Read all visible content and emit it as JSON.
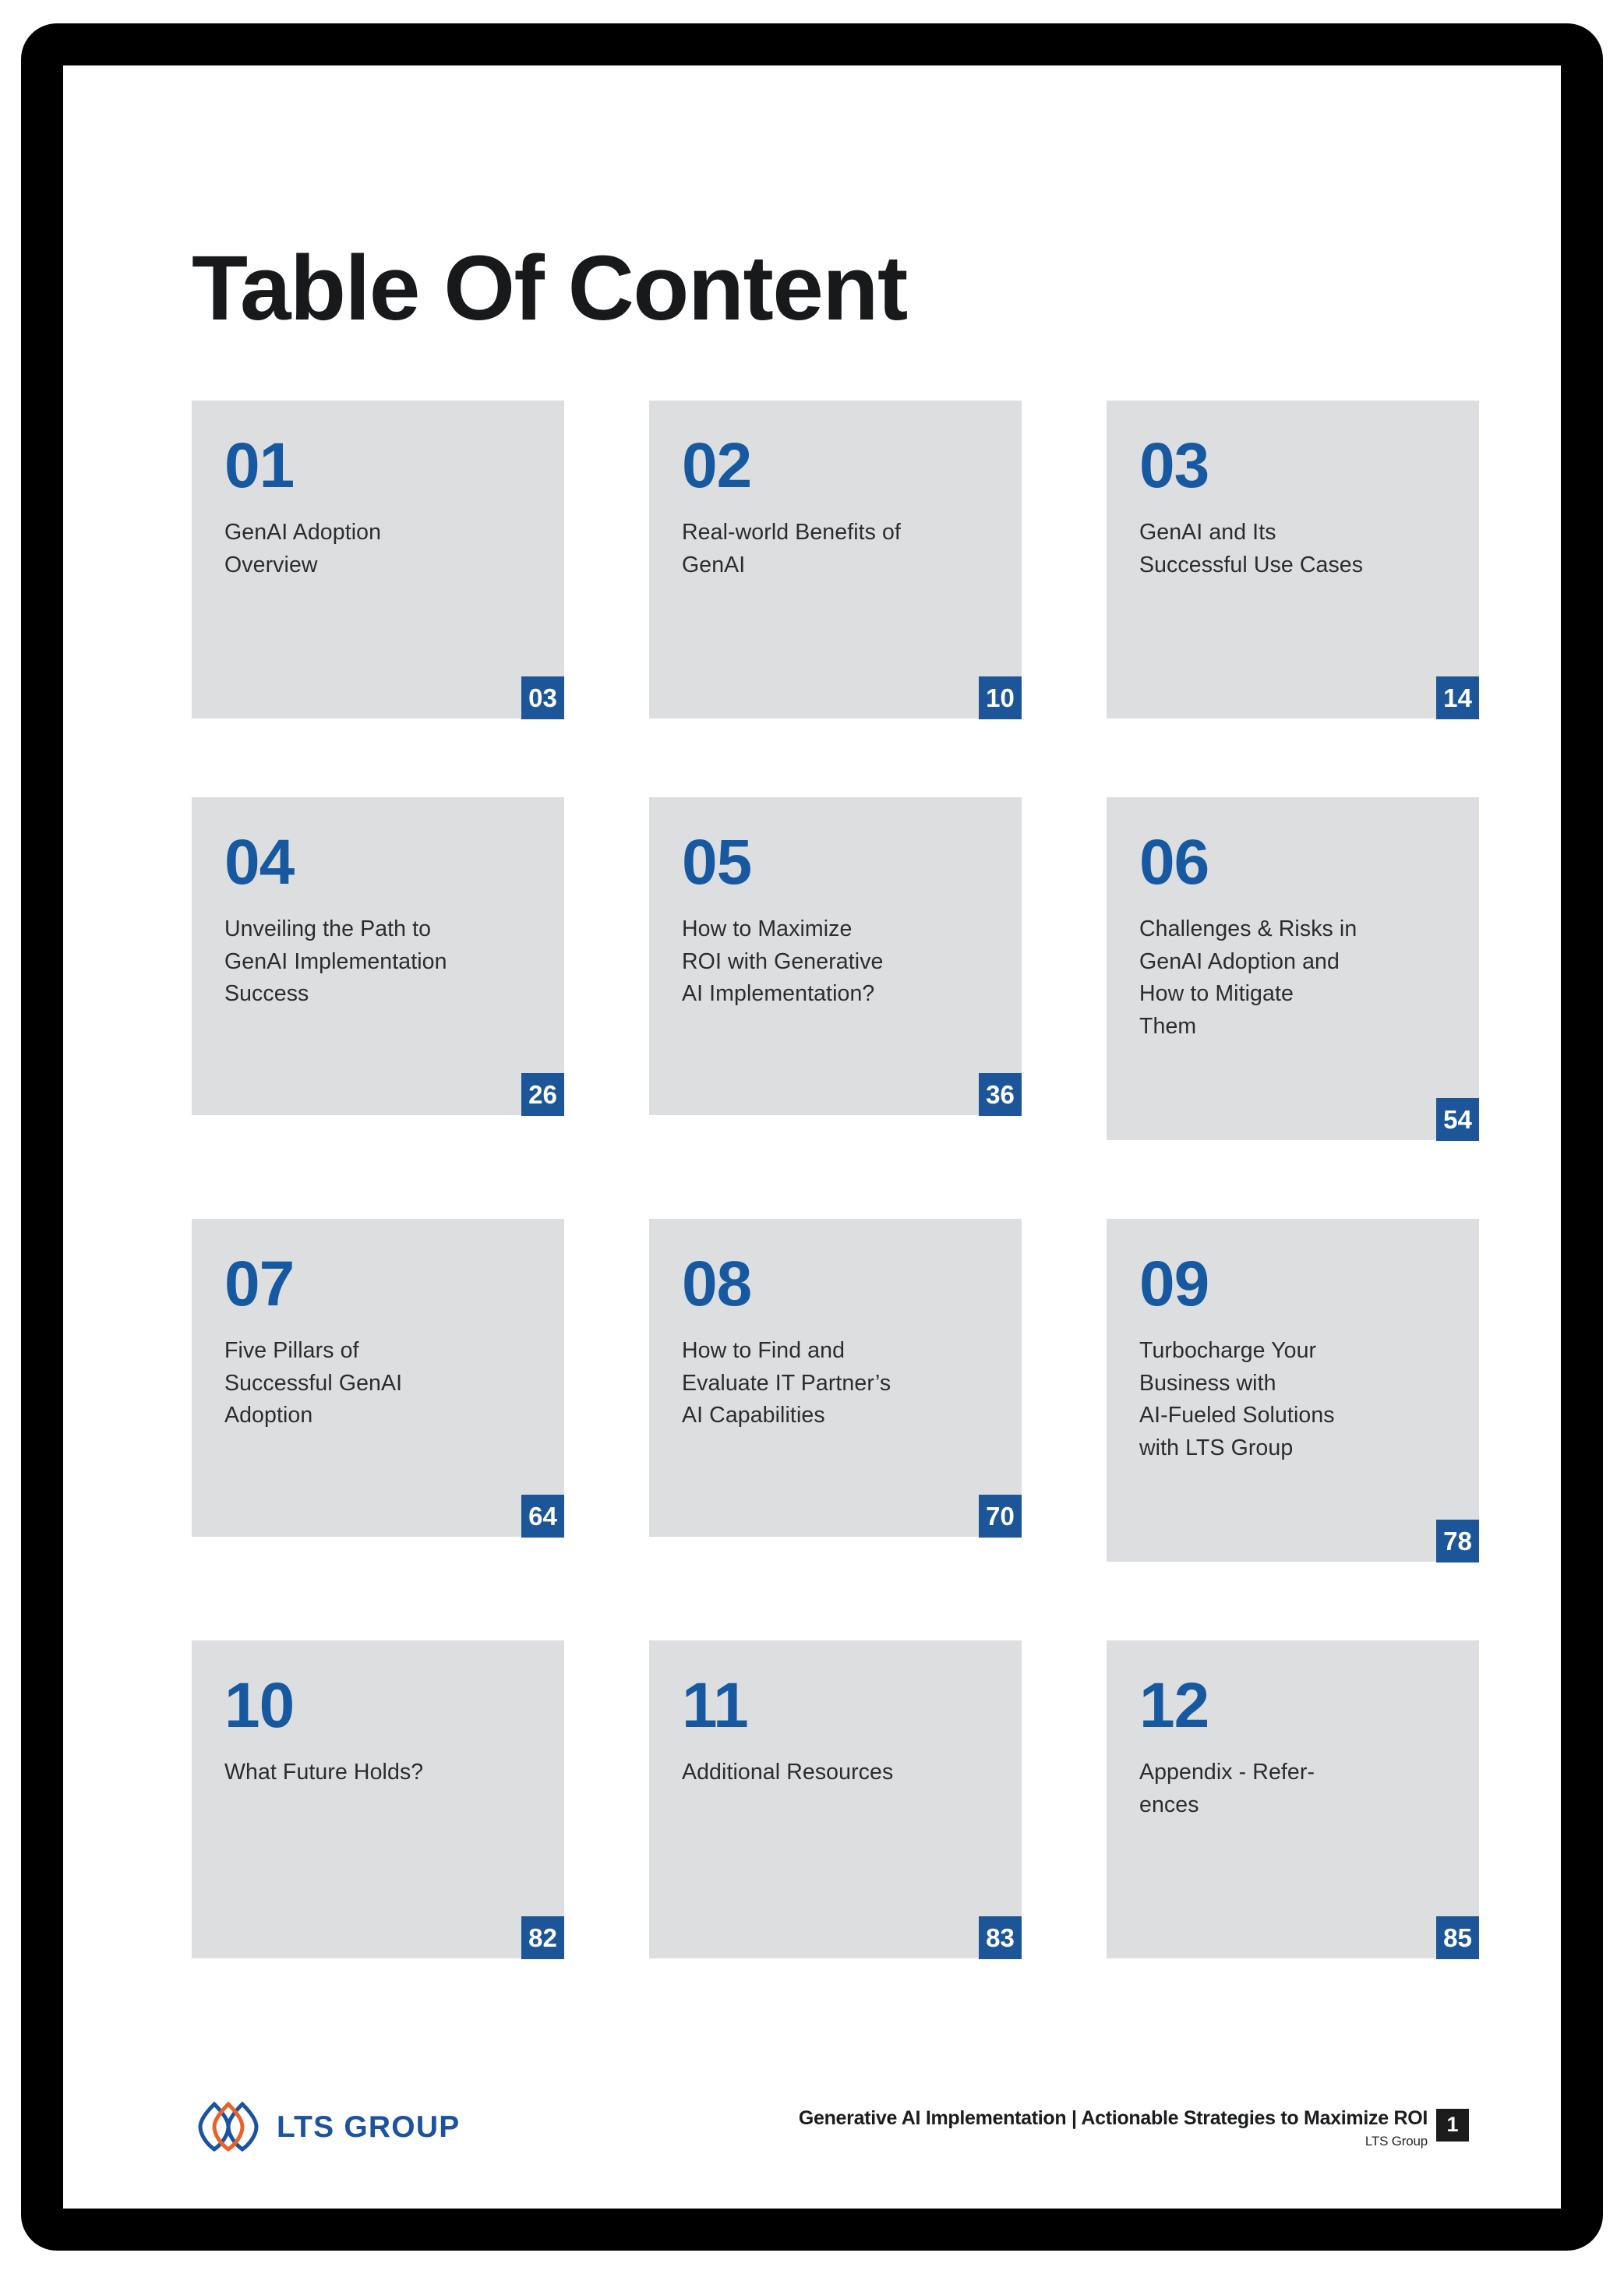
{
  "page": {
    "title": "Table Of Content",
    "accent_blue": "#1659a0",
    "badge_blue": "#1c5598",
    "card_grey": "#dddee0",
    "frame_black": "#000000"
  },
  "toc_items": [
    {
      "number": "01",
      "label": "GenAI Adoption\nOverview",
      "page": "03"
    },
    {
      "number": "02",
      "label": "Real-world Benefits of\nGenAI",
      "page": "10"
    },
    {
      "number": "03",
      "label": "GenAI and Its\nSuccessful Use Cases",
      "page": "14"
    },
    {
      "number": "04",
      "label": "Unveiling the Path to\nGenAI Implementation\nSuccess",
      "page": "26"
    },
    {
      "number": "05",
      "label": "How to Maximize\nROI with Generative\nAI Implementation?",
      "page": "36"
    },
    {
      "number": "06",
      "label": "Challenges & Risks in\nGenAI Adoption and\nHow to Mitigate\nThem",
      "page": "54"
    },
    {
      "number": "07",
      "label": "Five Pillars of\nSuccessful GenAI\nAdoption",
      "page": "64"
    },
    {
      "number": "08",
      "label": "How to Find and\nEvaluate IT Partner’s\nAI Capabilities",
      "page": "70"
    },
    {
      "number": "09",
      "label": "Turbocharge Your\nBusiness with\nAI-Fueled Solutions\nwith LTS Group",
      "page": "78"
    },
    {
      "number": "10",
      "label": "What Future Holds?",
      "page": "82"
    },
    {
      "number": "11",
      "label": "Additional Resources",
      "page": "83"
    },
    {
      "number": "12",
      "label": "Appendix - Refer-\nences",
      "page": "85"
    }
  ],
  "footer": {
    "logo_wordmark": "LTS GROUP",
    "logo_mark_name": "lts-group-flame-icon",
    "document_title": "Generative AI Implementation | Actionable Strategies to Maximize ROI",
    "company": "LTS Group",
    "page_number": "1"
  }
}
